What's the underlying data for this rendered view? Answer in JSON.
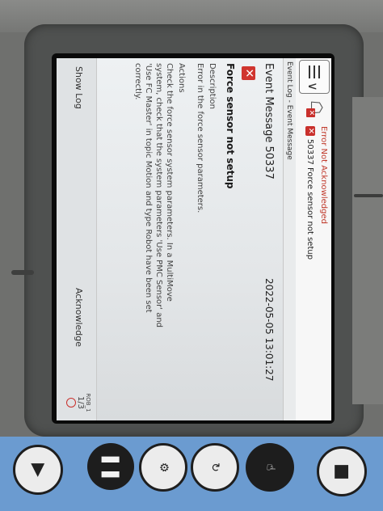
{
  "header": {
    "status": "Error Not Acknowledged",
    "message": "50337 Force sensor not setup"
  },
  "tab": "Event Log - Event Message",
  "event": {
    "title": "Event Message 50337",
    "timestamp": "2022-05-05 13:01:27",
    "heading": "Force sensor not setup",
    "description_label": "Description",
    "description_text": "Error in the force sensor parameters.",
    "actions_label": "Actions",
    "actions_text": "Check the force sensor system parameters. In a MultiMove system, check that the system parameters 'Use PMC Sensor' and 'Use FC Master' in topic Motion and type Robot have been set correctly."
  },
  "footer": {
    "show_log": "Show Log",
    "acknowledge": "Acknowledge",
    "task_name": "ROB_1",
    "task_fraction": "1/3"
  },
  "icons": {
    "menu": "menu-icon",
    "robot": "robot-icon",
    "error": "error-x-icon"
  },
  "colors": {
    "error": "#c9302c",
    "keypad": "#6b9bd0"
  }
}
